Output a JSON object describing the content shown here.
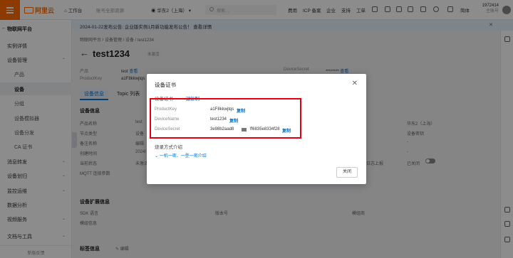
{
  "topbar": {
    "logo": "阿里云",
    "workbench": "工作台",
    "resource_group": "账号全部资源",
    "region": "华东2（上海）",
    "search_placeholder": "搜索...",
    "links": [
      "费用",
      "ICP 备案",
      "企业",
      "支持",
      "工单"
    ],
    "lang": "简体",
    "user_id": "1972414",
    "user_sub": "主账号"
  },
  "notice": {
    "text": "2024-01-22发布公告: 企业版实例1月新功能发布公告！ 查看详情"
  },
  "sidebar": {
    "header": "物联网平台",
    "items": [
      {
        "label": "实例详情",
        "type": "top"
      },
      {
        "label": "设备管理",
        "type": "group"
      },
      {
        "label": "产品",
        "type": "sub"
      },
      {
        "label": "设备",
        "type": "sub-active"
      },
      {
        "label": "分组",
        "type": "sub"
      },
      {
        "label": "设备模拟器",
        "type": "sub"
      },
      {
        "label": "设备分发",
        "type": "sub"
      },
      {
        "label": "CA 证书",
        "type": "sub"
      },
      {
        "label": "消息转发",
        "type": "group"
      },
      {
        "label": "设备划归",
        "type": "group"
      },
      {
        "label": "监控运维",
        "type": "group"
      },
      {
        "label": "数据分析",
        "type": "group"
      },
      {
        "label": "视频服务",
        "type": "group"
      },
      {
        "label": "文档与工具",
        "type": "top"
      }
    ],
    "footer": "新版反馈"
  },
  "main": {
    "breadcrumb": "物联网平台 / 设备管理 / 设备 / test1234",
    "title": "test1234",
    "badge": "未激活",
    "product_label": "产品",
    "product_value": "test",
    "product_link": "查看",
    "pk_label": "ProductKey",
    "pk_value": "a1F8kkwjtqs",
    "ds_label": "DeviceSecret",
    "ds_value": "********",
    "ds_link": "查看",
    "tabs": [
      "设备信息",
      "Topic 列表"
    ],
    "info_title": "设备信息",
    "fields": [
      "产品名称",
      "节点类型",
      "备注名称",
      "创建时间",
      "当前状态",
      "MQTT 连接参数"
    ],
    "field_values": [
      "test",
      "设备",
      "编辑",
      "2024/",
      "未激活"
    ],
    "right_values": [
      "华东2（上海）",
      "设备密钥",
      "-",
      "-",
      "已关闭"
    ],
    "right_label": "日志上报",
    "ext_title": "设备扩展信息",
    "ext_fields": [
      "SDK 语言",
      "版本号",
      "模组商",
      "模组信息"
    ],
    "tag_title": "标签信息",
    "tag_edit": "编辑"
  },
  "modal": {
    "title": "设备证书",
    "cert_label": "设备证书",
    "copy_all": "一键复制",
    "rows": [
      {
        "key": "ProductKey",
        "value": "a1F8kkwjtqs",
        "copy": "复制"
      },
      {
        "key": "DeviceName",
        "value": "test1234",
        "copy": "复制"
      },
      {
        "key": "DeviceSecret",
        "value": "3e98b2aad8",
        "value2": "ff6835e8334f28",
        "copy": "复制"
      }
    ],
    "burn_title": "烧录方式介绍",
    "expand": "一机一密、一型一密介绍",
    "close_btn": "关闭"
  },
  "colors": {
    "accent": "#ff6a00",
    "link": "#0070cc",
    "highlight": "#e5000f"
  }
}
